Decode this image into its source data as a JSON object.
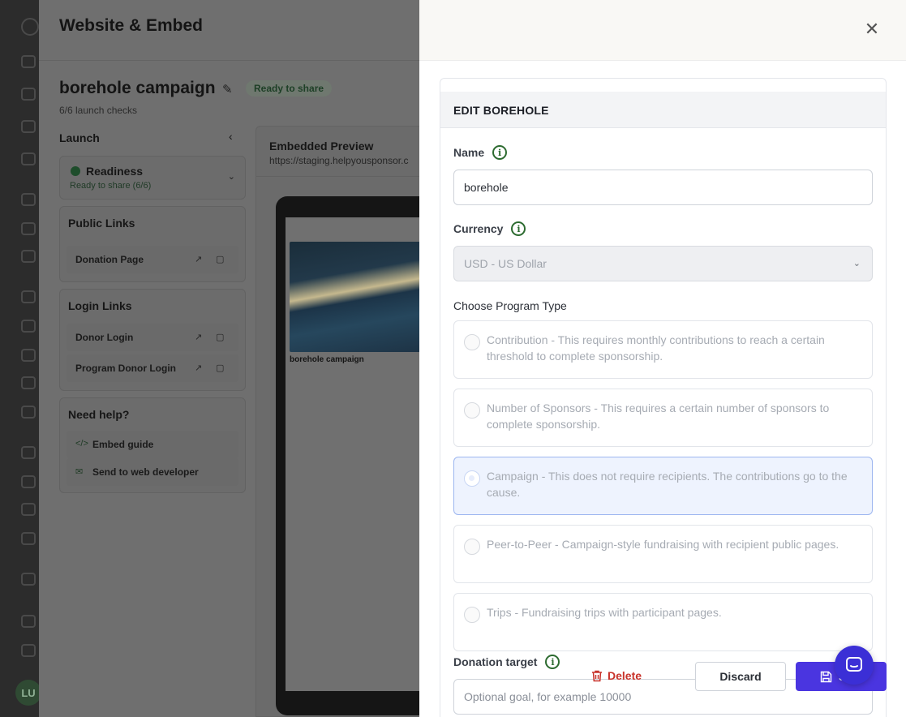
{
  "colors": {
    "accent": "#4a35e0",
    "danger": "#c8332b",
    "success": "#2d6b30"
  },
  "underlay": {
    "title": "Website & Embed",
    "campaign_name": "borehole campaign",
    "status_badge": "Ready to share",
    "launch_checks": "6/6 launch checks",
    "launch_heading": "Launch",
    "readiness": {
      "title": "Readiness",
      "subtitle": "Ready to share (6/6)"
    },
    "public_links": {
      "title": "Public Links",
      "items": [
        "Donation Page"
      ]
    },
    "login_links": {
      "title": "Login Links",
      "items": [
        "Donor Login",
        "Program Donor Login"
      ]
    },
    "help": {
      "title": "Need help?",
      "items": [
        "Embed guide",
        "Send to web developer"
      ]
    },
    "preview": {
      "title": "Embedded Preview",
      "url": "https://staging.helpyousponsor.c",
      "caption": "borehole campaign"
    },
    "avatar": "LU"
  },
  "drawer": {
    "panel_title": "EDIT BOREHOLE",
    "name": {
      "label": "Name",
      "value": "borehole"
    },
    "currency": {
      "label": "Currency",
      "value": "USD - US Dollar"
    },
    "program_type": {
      "label": "Choose Program Type",
      "selected_index": 2,
      "options": [
        "Contribution - This requires monthly contributions to reach a certain threshold to complete sponsorship.",
        "Number of Sponsors - This requires a certain number of sponsors to complete sponsorship.",
        "Campaign - This does not require recipients. The contributions go to the cause.",
        "Peer-to-Peer - Campaign-style fundraising with recipient public pages.",
        "Trips - Fundraising trips with participant pages."
      ]
    },
    "donation_target": {
      "label": "Donation target",
      "placeholder": "Optional goal, for example 10000"
    }
  },
  "actions": {
    "delete": "Delete",
    "discard": "Discard",
    "save": "S"
  }
}
